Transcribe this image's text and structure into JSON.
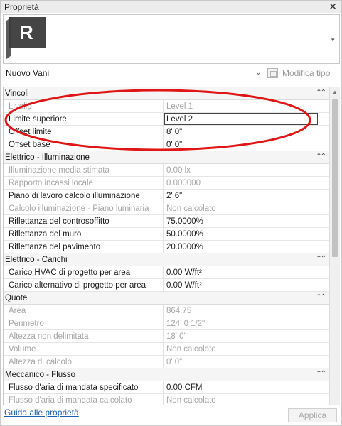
{
  "window": {
    "title": "Proprietà",
    "close_glyph": "✕"
  },
  "type_selector": {
    "value": "Nuovo Vani",
    "icon": "chevron-down-icon",
    "logo_letter": "R"
  },
  "edit_type": {
    "label": "Modifica tipo"
  },
  "groups": [
    {
      "name": "Vincoli",
      "rows": [
        {
          "label": "Livello",
          "value": "Level 1",
          "dim": true
        },
        {
          "label": "Limite superiore",
          "value": "Level 2",
          "dim": false,
          "editing": true
        },
        {
          "label": "Offset limite",
          "value": "8'  0\"",
          "dim": false
        },
        {
          "label": "Offset base",
          "value": "0'  0\"",
          "dim": false
        }
      ]
    },
    {
      "name": "Elettrico - Illuminazione",
      "rows": [
        {
          "label": "Illuminazione media stimata",
          "value": "0.00 lx",
          "dim": true
        },
        {
          "label": "Rapporto incassi locale",
          "value": "0.000000",
          "dim": true
        },
        {
          "label": "Piano di lavoro calcolo illuminazione",
          "value": "2'  6\"",
          "dim": false
        },
        {
          "label": "Calcolo illuminazione - Piano luminaria",
          "value": "Non calcolato",
          "dim": true
        },
        {
          "label": "Riflettanza del controsoffitto",
          "value": "75.0000%",
          "dim": false
        },
        {
          "label": "Riflettanza del muro",
          "value": "50.0000%",
          "dim": false
        },
        {
          "label": "Riflettanza del pavimento",
          "value": "20.0000%",
          "dim": false
        }
      ]
    },
    {
      "name": "Elettrico - Carichi",
      "rows": [
        {
          "label": "Carico HVAC di progetto per area",
          "value": "0.00 W/ft²",
          "dim": false
        },
        {
          "label": "Carico alternativo di progetto per area",
          "value": "0.00 W/ft²",
          "dim": false
        }
      ]
    },
    {
      "name": "Quote",
      "rows": [
        {
          "label": "Area",
          "value": "864.75",
          "dim": true
        },
        {
          "label": "Perimetro",
          "value": "124'  0 1/2\"",
          "dim": true
        },
        {
          "label": "Altezza non delimitata",
          "value": "18'  0\"",
          "dim": true
        },
        {
          "label": "Volume",
          "value": "Non calcolato",
          "dim": true
        },
        {
          "label": "Altezza di calcolo",
          "value": "0'  0\"",
          "dim": true
        }
      ]
    },
    {
      "name": "Meccanico - Flusso",
      "rows": [
        {
          "label": "Flusso d'aria di mandata specificato",
          "value": "0.00 CFM",
          "dim": false
        },
        {
          "label": "Flusso d'aria di mandata calcolato",
          "value": "Non calcolato",
          "dim": true
        }
      ]
    }
  ],
  "footer": {
    "help_link": "Guida alle proprietà",
    "apply_label": "Applica"
  },
  "colors": {
    "annotation_ellipse": "#e01515",
    "link": "#1a5fb4"
  }
}
